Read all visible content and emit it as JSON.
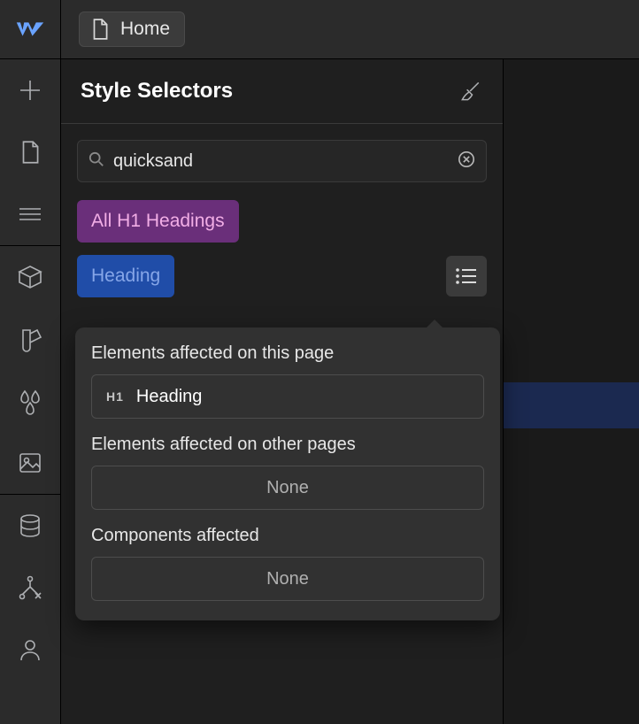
{
  "breadcrumb": {
    "label": "Home"
  },
  "panel": {
    "title": "Style Selectors"
  },
  "search": {
    "value": "quicksand"
  },
  "tags": {
    "all_h1": "All H1 Headings",
    "heading": "Heading"
  },
  "popover": {
    "section1_label": "Elements affected on this page",
    "element_badge": "H1",
    "element_name": "Heading",
    "section2_label": "Elements affected on other pages",
    "section2_value": "None",
    "section3_label": "Components affected",
    "section3_value": "None"
  }
}
